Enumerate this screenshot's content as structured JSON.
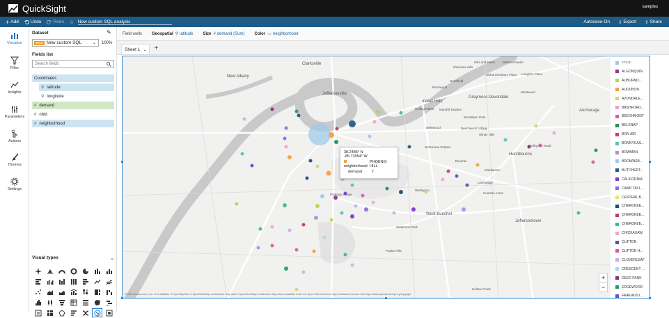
{
  "app": {
    "title": "QuickSight",
    "user": "samples"
  },
  "toolbar": {
    "add": "Add",
    "undo": "Undo",
    "redo": "Redo",
    "analysis_name": "New custom SQL analysis",
    "autosave": "Autosave On",
    "export": "Export",
    "share": "Share"
  },
  "rail": [
    {
      "label": "Visualize",
      "icon": "visualize-icon"
    },
    {
      "label": "Filter",
      "icon": "filter-icon"
    },
    {
      "label": "Insights",
      "icon": "insights-icon"
    },
    {
      "label": "Parameters",
      "icon": "parameters-icon"
    },
    {
      "label": "Actions",
      "icon": "actions-icon"
    },
    {
      "label": "Themes",
      "icon": "themes-icon"
    },
    {
      "label": "Settings",
      "icon": "settings-icon"
    }
  ],
  "dataset": {
    "heading": "Dataset",
    "badge": "SPICE",
    "name": "New custom SQL",
    "percent": "100%"
  },
  "fields": {
    "heading": "Fields list",
    "search_placeholder": "Search fields",
    "items": [
      {
        "label": "Coordinates",
        "kind": "group"
      },
      {
        "label": "latitude",
        "kind": "geo"
      },
      {
        "label": "longitude",
        "kind": "geo"
      },
      {
        "label": "demand",
        "kind": "measure"
      },
      {
        "label": "nbid",
        "kind": "dimension"
      },
      {
        "label": "neighborhood",
        "kind": "selected"
      }
    ]
  },
  "visual_types": {
    "heading": "Visual types"
  },
  "wells": {
    "label": "Field wells",
    "geospatial_label": "Geospatial",
    "geospatial_value": "latitude",
    "size_label": "Size",
    "size_value": "demand (Sum)",
    "color_label": "Color",
    "color_value": "neighborhood"
  },
  "sheet": {
    "name": "Sheet 1"
  },
  "tooltip": {
    "lat": "38.2485° N",
    "lon": "-85.73954° W",
    "neighborhood_label": "neighborhood",
    "neighborhood_value": "PHOENIX HILL",
    "demand_label": "demand",
    "demand_value": "7"
  },
  "legend": [
    {
      "label": "empty",
      "color": "#9ecae9"
    },
    {
      "label": "ALGONQUIN",
      "color": "#8e3a8e"
    },
    {
      "label": "AUBURND...",
      "color": "#b4d94a"
    },
    {
      "label": "AUDUBON",
      "color": "#f2a04a"
    },
    {
      "label": "AVONDALE...",
      "color": "#cddc6a"
    },
    {
      "label": "BASHFORD...",
      "color": "#f5a0c8"
    },
    {
      "label": "BEECHMONT",
      "color": "#d45fa5"
    },
    {
      "label": "BELKNAP",
      "color": "#2f8a52"
    },
    {
      "label": "BON AIR",
      "color": "#d23a78"
    },
    {
      "label": "BONNYCAS...",
      "color": "#5bc4b8"
    },
    {
      "label": "BOWMAN",
      "color": "#b48edc"
    },
    {
      "label": "BROWNSB...",
      "color": "#9ecae9"
    },
    {
      "label": "BUTCHERT...",
      "color": "#2a5a85"
    },
    {
      "label": "CALIFORNIA",
      "color": "#7a3fc4"
    },
    {
      "label": "CAMP TAYL...",
      "color": "#8a6fdb"
    },
    {
      "label": "CENTRAL B...",
      "color": "#d9e87e"
    },
    {
      "label": "CHEROKEE...",
      "color": "#1f4f6e"
    },
    {
      "label": "CHEROKEE...",
      "color": "#c43b6b"
    },
    {
      "label": "CHEROKEE...",
      "color": "#3bbf8c"
    },
    {
      "label": "CHICKASAW",
      "color": "#f4a6d0"
    },
    {
      "label": "CLIFTON",
      "color": "#6b4aa8"
    },
    {
      "label": "CLIFTON H...",
      "color": "#e15aa0"
    },
    {
      "label": "CLOVERLEAF",
      "color": "#c9b0ea"
    },
    {
      "label": "CRESCENT ...",
      "color": "#a9d6ef"
    },
    {
      "label": "DEER PARK",
      "color": "#8c2f7a"
    },
    {
      "label": "EDGEWOOD",
      "color": "#2a9a6c"
    },
    {
      "label": "FAIRGROU...",
      "color": "#6c4ec4"
    }
  ],
  "map": {
    "places": [
      {
        "name": "Clarksville"
      },
      {
        "name": "New Albany"
      },
      {
        "name": "Jeffersonville"
      },
      {
        "name": "Indian Hills"
      },
      {
        "name": "Graymoor-Devondale"
      },
      {
        "name": "Hurstbourne"
      },
      {
        "name": "Anchorage"
      },
      {
        "name": "Jeffersontown"
      },
      {
        "name": "West Buechel"
      },
      {
        "name": "Beuchel"
      },
      {
        "name": "Middletown"
      },
      {
        "name": "Hills and Dales"
      },
      {
        "name": "Glenview Hills"
      },
      {
        "name": "Old Brownsboro Place"
      },
      {
        "name": "Northfield"
      },
      {
        "name": "Riverwood"
      },
      {
        "name": "Rolling Fields"
      },
      {
        "name": "Maryhill Estates"
      },
      {
        "name": "Woodlawn Park"
      },
      {
        "name": "Bellewood"
      },
      {
        "name": "Beechwood Village"
      },
      {
        "name": "Windy Hills"
      },
      {
        "name": "Westwood"
      },
      {
        "name": "Langdon Place"
      },
      {
        "name": "Norbourne Estates"
      },
      {
        "name": "Wellington"
      },
      {
        "name": "Cambridge"
      },
      {
        "name": "Houston Acres"
      },
      {
        "name": "Watterson Park"
      },
      {
        "name": "Poplar Hills"
      },
      {
        "name": "Parkway Village"
      },
      {
        "name": "Hollow Creek"
      },
      {
        "name": "Barbourmeade"
      },
      {
        "name": "Shelbyville Road"
      }
    ],
    "attribution": "© 2021 Amazon.com, Inc. or its affiliates. © OpenMapTiles © OpenStreetMap contributors. Map data © OpenStreetMap contributors. Map data is available under the Open Data Commons Open Database License. See https://www.openstreetmap.org/copyright"
  }
}
